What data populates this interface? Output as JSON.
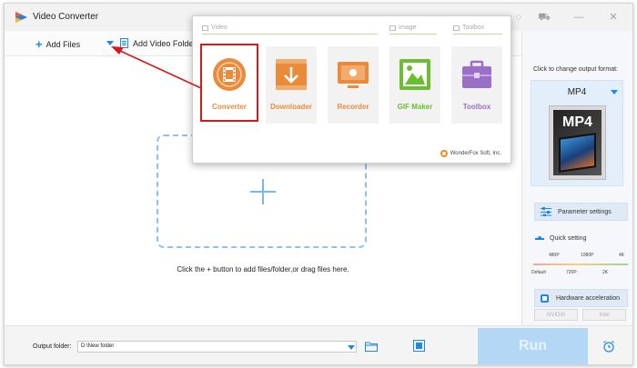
{
  "window": {
    "title": "Video Converter"
  },
  "toolbar": {
    "add_files_label": "Add Files",
    "add_folder_label": "Add Video Folder"
  },
  "main": {
    "hint": "Click the + button to add files/folder,or drag files here."
  },
  "popup": {
    "sections": {
      "video": "Video",
      "image": "Image",
      "toolbox": "Toolbox"
    },
    "tiles": [
      {
        "label": "Converter",
        "color": "#e98b3a"
      },
      {
        "label": "Downloader",
        "color": "#e98b3a"
      },
      {
        "label": "Recorder",
        "color": "#e98b3a"
      },
      {
        "label": "GIF Maker",
        "color": "#6abf2e"
      },
      {
        "label": "Toolbox",
        "color": "#9b6fc8"
      }
    ],
    "selected": "Converter",
    "brand": "WonderFox Soft, Inc."
  },
  "right_panel": {
    "change_format_label": "Click to change output format:",
    "format": "MP4",
    "format_art_text": "MP4",
    "parameter_settings": "Parameter settings",
    "quick_setting": "Quick setting",
    "ticks_top": [
      "480P",
      "1080P",
      "4K"
    ],
    "ticks_bottom": [
      "Default",
      "720P",
      "2K"
    ],
    "hardware_acceleration": "Hardware acceleration",
    "vendors": [
      "NVIDIA",
      "Intel"
    ]
  },
  "bottom": {
    "output_folder_label": "Output folder:",
    "output_folder_value": "D:\\New folder",
    "run_label": "Run"
  },
  "colors": {
    "accent": "#1e88e5",
    "highlight": "#d31a1a",
    "run_button": "#b3d7f5"
  }
}
